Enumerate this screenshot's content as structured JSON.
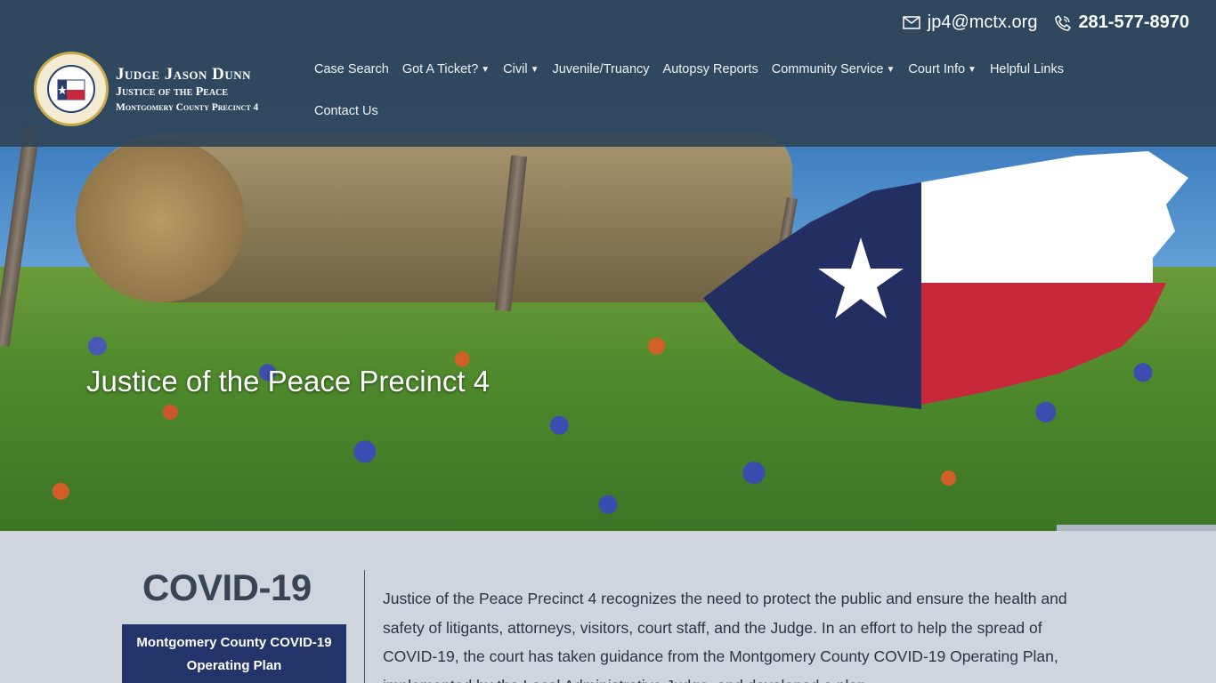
{
  "contact": {
    "email": "jp4@mctx.org",
    "phone": "281-577-8970"
  },
  "brand": {
    "line1": "Judge Jason Dunn",
    "line2": "Justice of the Peace",
    "line3": "Montgomery County Precinct 4"
  },
  "nav": {
    "items": [
      {
        "label": "Case Search",
        "dropdown": false
      },
      {
        "label": "Got A Ticket?",
        "dropdown": true
      },
      {
        "label": "Civil",
        "dropdown": true
      },
      {
        "label": "Juvenile/Truancy",
        "dropdown": false
      },
      {
        "label": "Autopsy Reports",
        "dropdown": false
      },
      {
        "label": "Community Service",
        "dropdown": true
      },
      {
        "label": "Court Info",
        "dropdown": true
      },
      {
        "label": "Helpful Links",
        "dropdown": false
      }
    ],
    "row2": [
      {
        "label": "Contact Us",
        "dropdown": false
      }
    ]
  },
  "hero": {
    "title": "Justice of the Peace Precinct 4"
  },
  "covid": {
    "title": "COVID-19",
    "button": "Montgomery County COVID-19 Operating Plan",
    "text": "Justice of the Peace Precinct 4 recognizes the need to protect the public and ensure the health and safety of litigants, attorneys, visitors, court staff, and the Judge. In an effort to help the spread of COVID-19, the court has taken guidance from the Montgomery County COVID-19 Operating Plan, implemented by the Local Administrative Judge, and developed a plan"
  },
  "colors": {
    "header_bg": "#304458",
    "button_bg": "#22346a",
    "flag_blue": "#232f63",
    "flag_red": "#c8283c"
  }
}
